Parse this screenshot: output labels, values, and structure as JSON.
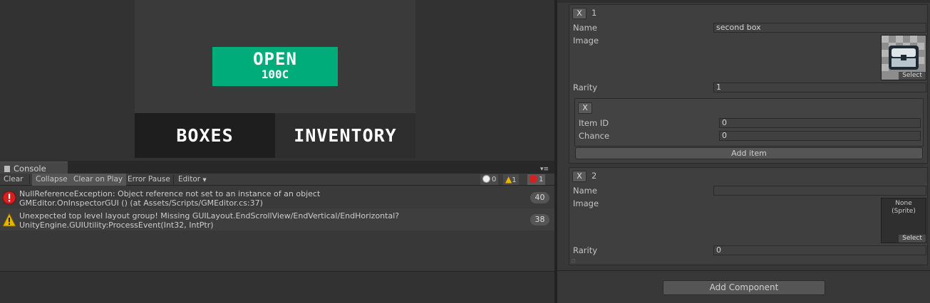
{
  "game": {
    "open_button": {
      "label": "OPEN",
      "price": "100C"
    },
    "tabs": [
      {
        "label": "BOXES"
      },
      {
        "label": "INVENTORY"
      }
    ]
  },
  "console": {
    "tab_label": "Console",
    "toolbar": {
      "clear": "Clear",
      "collapse": "Collapse",
      "clear_on_play": "Clear on Play",
      "error_pause": "Error Pause",
      "editor": "Editor",
      "info_count": "0",
      "warning_count": "1",
      "error_count": "1"
    },
    "entries": [
      {
        "type": "error",
        "line1": "NullReferenceException: Object reference not set to an instance of an object",
        "line2": "GMEditor.OnInspectorGUI () (at Assets/Scripts/GMEditor.cs:37)",
        "count": "40"
      },
      {
        "type": "warning",
        "line1": "Unexpected top level layout group! Missing GUILayout.EndScrollView/EndVertical/EndHorizontal?",
        "line2": "UnityEngine.GUIUtility:ProcessEvent(Int32, IntPtr)",
        "count": "38"
      }
    ]
  },
  "inspector": {
    "boxes": [
      {
        "remove_label": "X",
        "index": "1",
        "name_label": "Name",
        "name_value": "second box",
        "image_label": "Image",
        "image_select": "Select",
        "rarity_label": "Rarity",
        "rarity_value": "1",
        "items": [
          {
            "remove_label": "X",
            "item_id_label": "Item ID",
            "item_id_value": "0",
            "chance_label": "Chance",
            "chance_value": "0"
          }
        ],
        "add_item_label": "Add item"
      },
      {
        "remove_label": "X",
        "index": "2",
        "name_label": "Name",
        "name_value": "",
        "image_label": "Image",
        "image_none": "None",
        "image_type": "(Sprite)",
        "image_select": "Select",
        "rarity_label": "Rarity",
        "rarity_value": "0"
      }
    ],
    "add_component_label": "Add Component"
  },
  "colors": {
    "accent_green": "#00ad7a",
    "error_red": "#d42020",
    "warning_yellow": "#e8b400"
  }
}
